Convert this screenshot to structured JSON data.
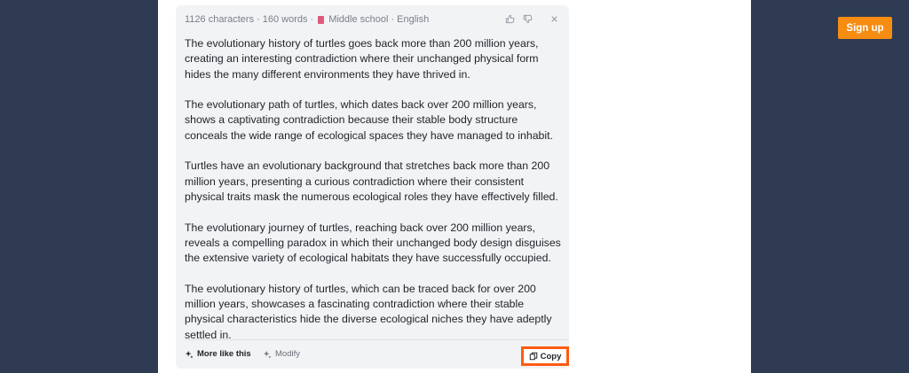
{
  "card": {
    "meta": {
      "characters": "1126 characters",
      "words": "160 words",
      "level": "Middle school",
      "language": "English",
      "separator": "·"
    },
    "paragraphs": [
      "The evolutionary history of turtles goes back more than 200 million years, creating an interesting contradiction where their unchanged physical form hides the many different environments they have thrived in.",
      "The evolutionary path of turtles, which dates back over 200 million years, shows a captivating contradiction because their stable body structure conceals the wide range of ecological spaces they have managed to inhabit.",
      "Turtles have an evolutionary background that stretches back more than 200 million years, presenting a curious contradiction where their consistent physical traits mask the numerous ecological roles they have effectively filled.",
      "The evolutionary journey of turtles, reaching back over 200 million years, reveals a compelling paradox in which their unchanged body design disguises the extensive variety of ecological habitats they have successfully occupied.",
      "The evolutionary history of turtles, which can be traced back for over 200 million years, showcases a fascinating contradiction where their stable physical characteristics hide the diverse ecological niches they have adeptly settled in."
    ],
    "footer": {
      "more_like_this": "More like this",
      "modify": "Modify",
      "copy": "Copy"
    }
  },
  "header": {
    "signup": "Sign up"
  },
  "colors": {
    "background": "#2e3b52",
    "accent": "#f78c12",
    "highlight": "#ff5b12"
  },
  "icons": [
    "book-icon",
    "thumbs-up-icon",
    "thumbs-down-icon",
    "close-icon",
    "sparkle-icon",
    "copy-icon"
  ]
}
